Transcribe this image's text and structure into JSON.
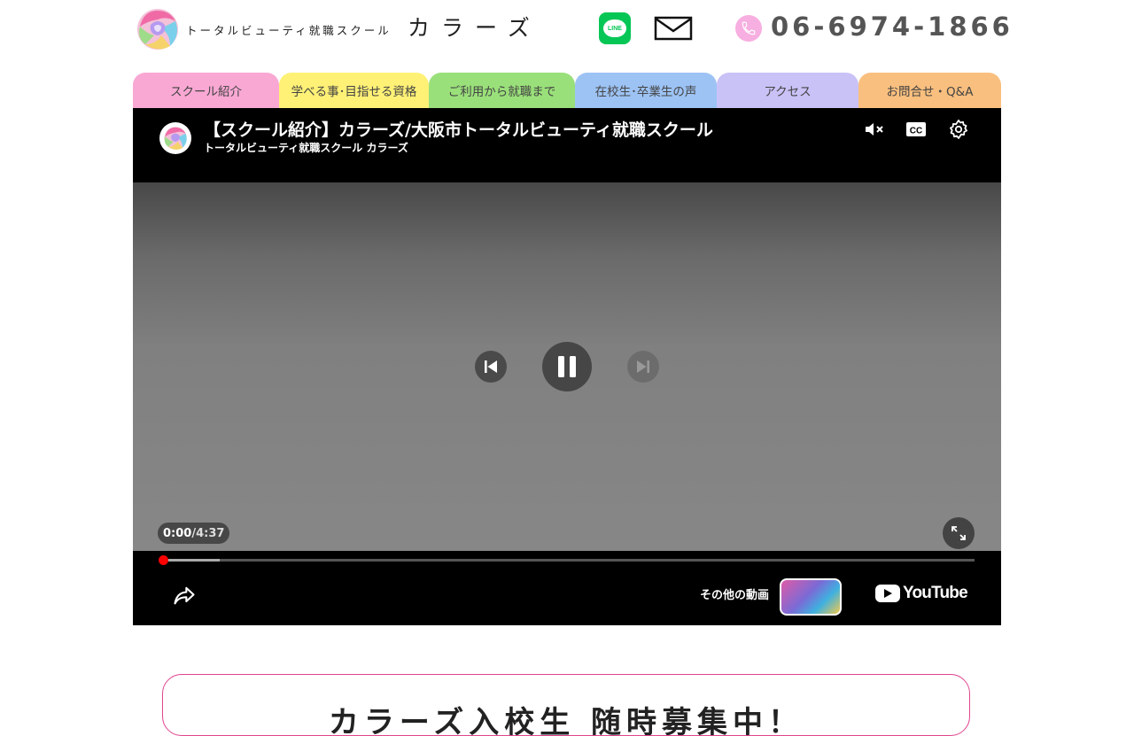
{
  "header": {
    "school_subtitle": "トータルビューティ就職スクール",
    "school_name": "カラーズ",
    "line_label": "LINE",
    "phone": "06-6974-1866"
  },
  "nav": {
    "tabs": [
      {
        "label": "スクール紹介",
        "color": "#f9a8d4"
      },
      {
        "label": "学べる事･目指せる資格",
        "color": "#fff176"
      },
      {
        "label": "ご利用から就職まで",
        "color": "#9ae07a"
      },
      {
        "label": "在校生･卒業生の声",
        "color": "#9dc3f5"
      },
      {
        "label": "アクセス",
        "color": "#c9c2f7"
      },
      {
        "label": "お問合せ・Q&A",
        "color": "#f9bf7e"
      }
    ]
  },
  "video": {
    "title": "【スクール紹介】カラーズ/大阪市トータルビューティ就職スクール",
    "channel": "トータルビューティ就職スクール カラーズ",
    "time_current": "0:00",
    "time_separator": " / ",
    "time_duration": "4:37",
    "buffered_fraction": 0.07,
    "more_videos_label": "その他の動画",
    "youtube_label": "YouTube"
  },
  "notice": {
    "text": "カラーズ入校生 随時募集中！"
  },
  "colors": {
    "accent_pink": "#e0458f",
    "line_green": "#06c755",
    "progress_red": "#ff0000"
  }
}
